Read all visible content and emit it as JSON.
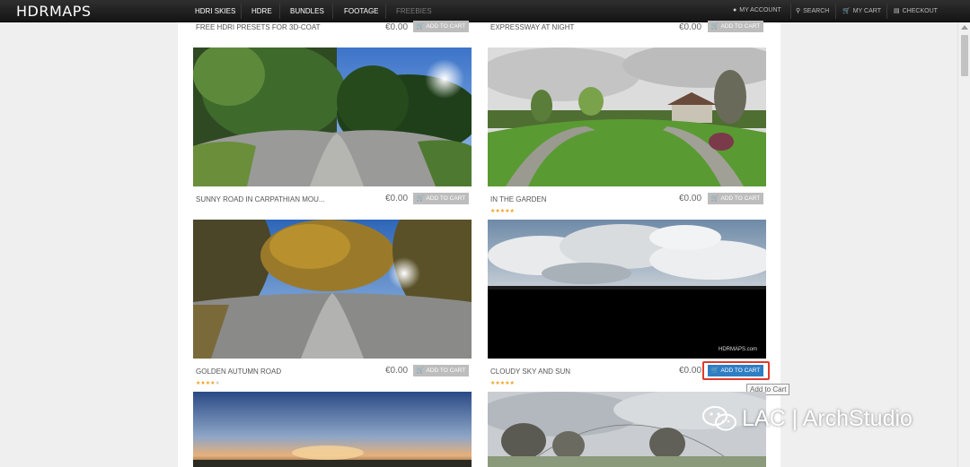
{
  "nav": {
    "logo": "HDRMAPS",
    "items": [
      {
        "label": "HDRI SKIES"
      },
      {
        "label": "HDRE"
      },
      {
        "label": "BUNDLES"
      },
      {
        "label": "FOOTAGE"
      },
      {
        "label": "FREEBIES"
      }
    ],
    "utility": [
      {
        "label": "MY ACCOUNT",
        "icon": "user-icon"
      },
      {
        "label": "SEARCH",
        "icon": "search-icon"
      },
      {
        "label": "MY CART",
        "icon": "cart-icon"
      },
      {
        "label": "CHECKOUT",
        "icon": "checkout-icon"
      }
    ]
  },
  "products": [
    {
      "title": "FREE HDRI PRESETS FOR 3D-COAT",
      "price": "€0.00",
      "button": "ADD TO CART"
    },
    {
      "title": "EXPRESSWAY AT NIGHT",
      "price": "€0.00",
      "button": "ADD TO CART"
    },
    {
      "title": "SUNNY ROAD IN CARPATHIAN MOU...",
      "price": "€0.00",
      "button": "ADD TO CART",
      "rating": 0
    },
    {
      "title": "IN THE GARDEN",
      "price": "€0.00",
      "button": "ADD TO CART",
      "rating": 5
    },
    {
      "title": "GOLDEN AUTUMN ROAD",
      "price": "€0.00",
      "button": "ADD TO CART",
      "rating": 4
    },
    {
      "title": "CLOUDY SKY AND SUN",
      "price": "€0.00",
      "button": "ADD TO CART",
      "rating": 5,
      "button_state": "hover"
    }
  ],
  "thumb_watermark": "HDRMAPS.com",
  "tooltip": "Add to Cart",
  "watermark": "LAC | ArchStudio",
  "colors": {
    "nav_bg": "#1b1b1b",
    "button_default": "#bdbdbd",
    "button_active": "#2f7ec4",
    "star": "#f0a020",
    "highlight": "#e03a2a"
  }
}
